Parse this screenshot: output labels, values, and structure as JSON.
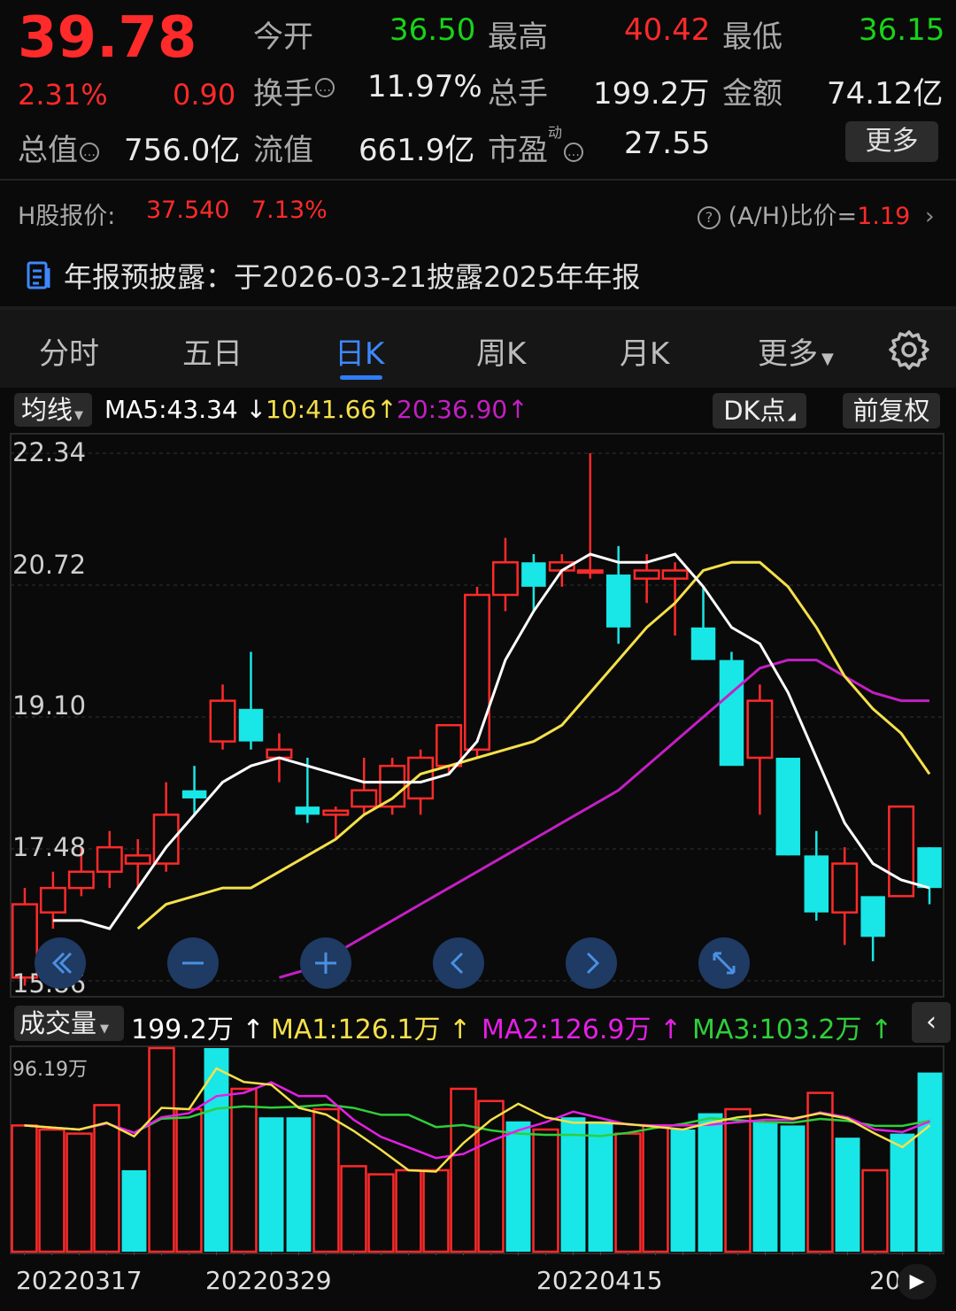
{
  "quote": {
    "price": "39.78",
    "change_pct": "2.31%",
    "change": "0.90",
    "rows": [
      [
        {
          "label": "今开",
          "value": "36.50",
          "vcolor": "green"
        },
        {
          "label": "最高",
          "value": "40.42",
          "vcolor": "red"
        },
        {
          "label": "最低",
          "value": "36.15",
          "vcolor": "green"
        }
      ],
      [
        {
          "label": "换手",
          "value": "11.97%",
          "vcolor": "white"
        },
        {
          "label": "总手",
          "value": "199.2万",
          "vcolor": "white"
        },
        {
          "label": "金额",
          "value": "74.12亿",
          "vcolor": "white"
        }
      ]
    ],
    "row3": {
      "total_value_label": "总值",
      "total_value": "756.0亿",
      "float_label": "流值",
      "float_value": "661.9亿",
      "pe_label": "市盈",
      "pe_sup": "动",
      "pe_value": "27.55"
    },
    "more_button": "更多"
  },
  "hshare": {
    "label": "H股报价:",
    "price": "37.540",
    "pct": "7.13%",
    "ratio_label": "(A/H)比价=",
    "ratio": "1.19"
  },
  "notice": {
    "text": "年报预披露：于2026-03-21披露2025年年报"
  },
  "tabs": [
    {
      "label": "分时",
      "active": false
    },
    {
      "label": "五日",
      "active": false
    },
    {
      "label": "日K",
      "active": true
    },
    {
      "label": "周K",
      "active": false
    },
    {
      "label": "月K",
      "active": false
    },
    {
      "label": "更多",
      "active": false
    }
  ],
  "ma_bar": {
    "selector": "均线",
    "ma5": "MA5:43.34",
    "ma10": "10:41.66",
    "ma20": "20:36.90",
    "dk": "DK点",
    "fq": "前复权"
  },
  "vol_bar": {
    "selector": "成交量",
    "vol": "199.2万",
    "ma1": "MA1:126.1万",
    "ma2": "MA2:126.9万",
    "ma3": "MA3:103.2万",
    "max_label": "96.19万"
  },
  "colors": {
    "up": "#ff2a2a",
    "down": "#19e6e6",
    "ma5": "#ffffff",
    "ma10": "#f5e04a",
    "ma20": "#c41fc4",
    "vma3": "#2fcf3a"
  },
  "chart_data": [
    {
      "type": "candlestick",
      "ylim": [
        15.86,
        22.34
      ],
      "yticks": [
        "22.34",
        "20.72",
        "19.10",
        "17.48",
        "15.86"
      ],
      "candles": [
        {
          "o": 15.9,
          "h": 17.0,
          "l": 15.8,
          "c": 16.8
        },
        {
          "o": 16.7,
          "h": 17.2,
          "l": 16.5,
          "c": 17.0
        },
        {
          "o": 17.0,
          "h": 17.5,
          "l": 16.9,
          "c": 17.2
        },
        {
          "o": 17.2,
          "h": 17.7,
          "l": 17.0,
          "c": 17.5
        },
        {
          "o": 17.3,
          "h": 17.6,
          "l": 17.0,
          "c": 17.4
        },
        {
          "o": 17.3,
          "h": 18.3,
          "l": 17.2,
          "c": 17.9
        },
        {
          "o": 18.2,
          "h": 18.5,
          "l": 17.9,
          "c": 18.1
        },
        {
          "o": 18.8,
          "h": 19.5,
          "l": 18.7,
          "c": 19.3
        },
        {
          "o": 19.2,
          "h": 19.9,
          "l": 18.7,
          "c": 18.8
        },
        {
          "o": 18.6,
          "h": 18.9,
          "l": 18.3,
          "c": 18.7
        },
        {
          "o": 18.0,
          "h": 18.6,
          "l": 17.8,
          "c": 17.9
        },
        {
          "o": 17.9,
          "h": 18.0,
          "l": 17.6,
          "c": 17.95
        },
        {
          "o": 18.0,
          "h": 18.6,
          "l": 17.9,
          "c": 18.2
        },
        {
          "o": 18.0,
          "h": 18.6,
          "l": 17.9,
          "c": 18.5
        },
        {
          "o": 18.1,
          "h": 18.7,
          "l": 17.9,
          "c": 18.6
        },
        {
          "o": 18.5,
          "h": 19.0,
          "l": 18.4,
          "c": 19.0
        },
        {
          "o": 18.7,
          "h": 20.7,
          "l": 18.6,
          "c": 20.6
        },
        {
          "o": 20.6,
          "h": 21.3,
          "l": 20.4,
          "c": 21.0
        },
        {
          "o": 21.0,
          "h": 21.1,
          "l": 20.4,
          "c": 20.7
        },
        {
          "o": 20.9,
          "h": 21.1,
          "l": 20.7,
          "c": 21.0
        },
        {
          "o": 20.9,
          "h": 22.34,
          "l": 20.8,
          "c": 20.9
        },
        {
          "o": 20.85,
          "h": 21.2,
          "l": 20.0,
          "c": 20.2
        },
        {
          "o": 20.8,
          "h": 21.1,
          "l": 20.5,
          "c": 20.9
        },
        {
          "o": 20.8,
          "h": 21.0,
          "l": 20.1,
          "c": 20.9
        },
        {
          "o": 20.2,
          "h": 20.7,
          "l": 19.8,
          "c": 19.8
        },
        {
          "o": 19.8,
          "h": 19.9,
          "l": 18.6,
          "c": 18.5
        },
        {
          "o": 18.6,
          "h": 19.5,
          "l": 17.9,
          "c": 19.3
        },
        {
          "o": 18.6,
          "h": 18.5,
          "l": 17.4,
          "c": 17.4
        },
        {
          "o": 17.4,
          "h": 17.7,
          "l": 16.6,
          "c": 16.7
        },
        {
          "o": 16.7,
          "h": 17.5,
          "l": 16.3,
          "c": 17.3
        },
        {
          "o": 16.9,
          "h": 16.8,
          "l": 16.1,
          "c": 16.4
        },
        {
          "o": 16.9,
          "h": 18.0,
          "l": 16.9,
          "c": 18.0
        },
        {
          "o": 17.5,
          "h": 17.5,
          "l": 16.8,
          "c": 17.0
        }
      ],
      "ma5": [
        16.6,
        16.6,
        16.5,
        17.0,
        17.5,
        17.9,
        18.3,
        18.5,
        18.6,
        18.5,
        18.4,
        18.3,
        18.3,
        18.3,
        18.4,
        18.8,
        19.8,
        20.4,
        20.9,
        21.1,
        21.0,
        21.0,
        21.1,
        20.7,
        20.2,
        20.0,
        19.4,
        18.6,
        17.8,
        17.3,
        17.1,
        17.0
      ],
      "ma10": [
        16.5,
        16.8,
        16.9,
        17.0,
        17.0,
        17.2,
        17.4,
        17.6,
        17.9,
        18.1,
        18.4,
        18.5,
        18.6,
        18.7,
        18.8,
        19.0,
        19.4,
        19.8,
        20.2,
        20.5,
        20.9,
        21.0,
        21.0,
        20.7,
        20.2,
        19.6,
        19.2,
        18.9,
        18.4
      ],
      "ma20": [
        15.9,
        16.0,
        16.2,
        16.4,
        16.6,
        16.8,
        17.0,
        17.2,
        17.4,
        17.6,
        17.8,
        18.0,
        18.2,
        18.5,
        18.8,
        19.1,
        19.4,
        19.7,
        19.8,
        19.8,
        19.6,
        19.4,
        19.3,
        19.3
      ]
    },
    {
      "type": "volume_bar",
      "ylim": [
        0,
        100
      ],
      "values": [
        62,
        60,
        58,
        72,
        40,
        100,
        70,
        100,
        80,
        66,
        66,
        70,
        42,
        38,
        40,
        40,
        80,
        74,
        64,
        60,
        66,
        64,
        58,
        62,
        60,
        68,
        70,
        64,
        62,
        78,
        56,
        40,
        58,
        88
      ],
      "up": [
        true,
        true,
        true,
        true,
        false,
        true,
        true,
        false,
        true,
        false,
        false,
        true,
        true,
        true,
        true,
        true,
        true,
        true,
        false,
        true,
        false,
        false,
        true,
        true,
        false,
        false,
        true,
        false,
        false,
        true,
        false,
        true,
        false,
        false
      ],
      "x_ticks": [
        "20220317",
        "20220329",
        "20220415",
        "20"
      ]
    }
  ]
}
